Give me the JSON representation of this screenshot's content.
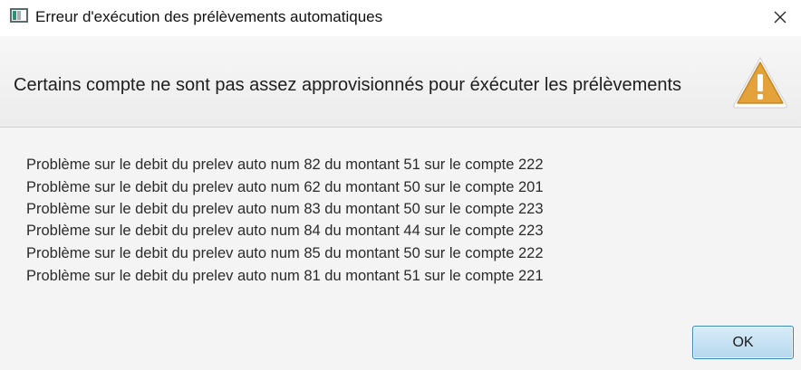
{
  "window": {
    "title": "Erreur d'exécution des prélèvements automatiques",
    "icon": "java-app-icon",
    "close_icon": "close-icon"
  },
  "header": {
    "text": "Certains compte ne sont pas assez approvisionnés pour éxécuter les prélèvements",
    "icon": "warning-icon",
    "icon_color": "#e3a33a"
  },
  "content": {
    "lines": [
      "Problème sur le debit du prelev auto num 82 du montant 51 sur le compte 222",
      "Problème sur le debit du prelev auto num 62 du montant 50 sur le compte 201",
      "Problème sur le debit du prelev auto num 83 du montant 50 sur le compte 223",
      "Problème sur le debit du prelev auto num 84 du montant 44 sur le compte 223",
      "Problème sur le debit du prelev auto num 85 du montant 50 sur le compte 222",
      "Problème sur le debit du prelev auto num 81 du montant 51 sur le compte 221"
    ]
  },
  "buttons": {
    "ok_label": "OK"
  }
}
